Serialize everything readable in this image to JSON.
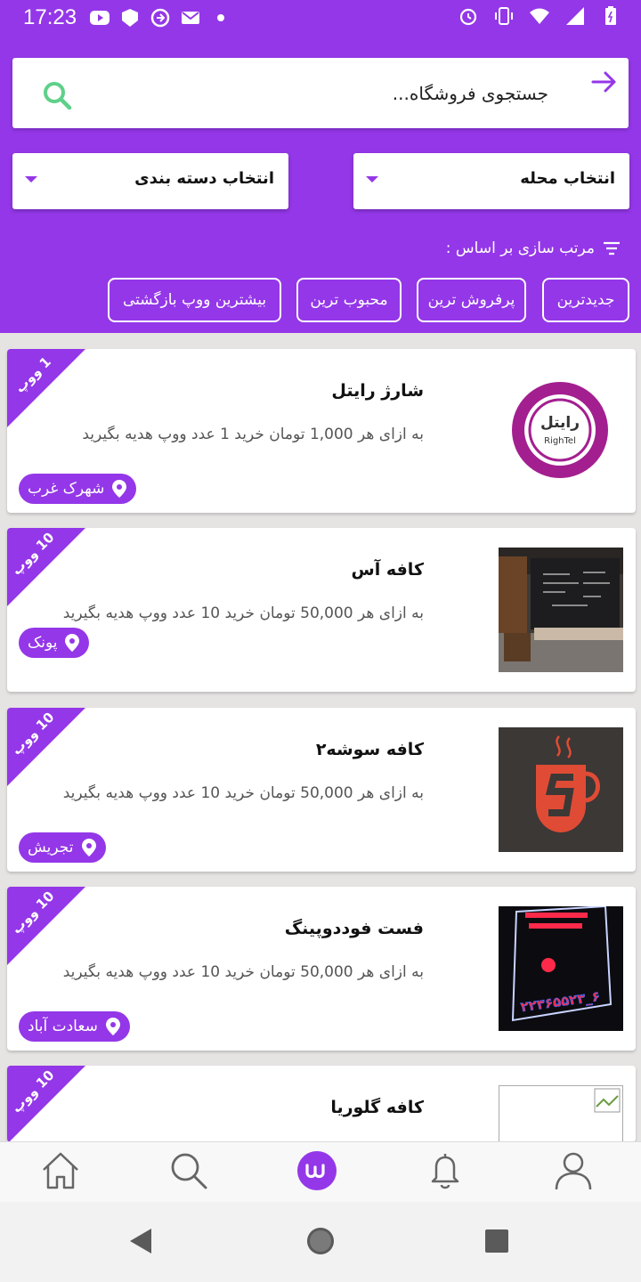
{
  "status_bar": {
    "time": "17:23",
    "icons_left": [
      "youtube-icon",
      "shield-icon",
      "sync-icon",
      "mail-icon",
      "dot-icon"
    ],
    "icons_right": [
      "alarm-icon",
      "vibrate-icon",
      "wifi-icon",
      "signal-icon",
      "battery-icon"
    ]
  },
  "search": {
    "placeholder": "جستجوی فروشگاه..."
  },
  "filters": {
    "neighborhood_label": "انتخاب محله",
    "category_label": "انتخاب دسته بندی"
  },
  "sort": {
    "label": "مرتب سازی بر اساس :",
    "options": [
      "جدیدترین",
      "پرفروش ترین",
      "محبوب ترین",
      "بیشترین ووپ بازگشتی"
    ]
  },
  "stores": [
    {
      "title": "شارژ رایتل",
      "description": "به ازای هر 1,000 تومان خرید 1 عدد ووپ هدیه بگیرید",
      "ribbon": "1 ووپ",
      "location": "شهرک غرب",
      "logo_text": "رایتل",
      "logo_sub": "RighTel"
    },
    {
      "title": "کافه آس",
      "description": "به ازای هر 50,000 تومان خرید 10 عدد ووپ هدیه بگیرید",
      "ribbon": "10 ووپ",
      "location": "پونک"
    },
    {
      "title": "کافه سوشه۲",
      "description": "به ازای هر 50,000 تومان خرید 10 عدد ووپ هدیه بگیرید",
      "ribbon": "10 ووپ",
      "location": "تجریش"
    },
    {
      "title": "فست فوددوپینگ",
      "description": "به ازای هر 50,000 تومان خرید 10 عدد ووپ هدیه بگیرید",
      "ribbon": "10 ووپ",
      "location": "سعادت آباد",
      "sign_text": "۲۲۳۶۵۵۲۳_۶"
    },
    {
      "title": "کافه گلوریا",
      "ribbon": "10 ووپ"
    }
  ],
  "bottom_nav": [
    "home-icon",
    "search-icon",
    "woop-icon",
    "bell-icon",
    "profile-icon"
  ],
  "colors": {
    "primary": "#9437e8",
    "search_icon": "#5fd08a"
  }
}
